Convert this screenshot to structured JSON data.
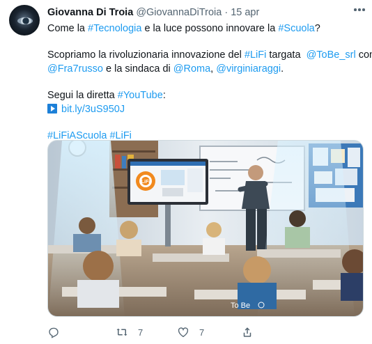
{
  "tweet": {
    "author_name": "Giovanna Di Troia",
    "author_handle": "@GiovannaDiTroia",
    "separator": "·",
    "date": "15 apr",
    "body": {
      "l1": {
        "a": "Come la ",
        "b": "#Tecnologia",
        "c": " e la luce possono innovare la ",
        "d": "#Scuola",
        "e": "?"
      },
      "l2": {
        "a": "Scopriamo la rivoluzionaria innovazione del ",
        "b": "#LiFi",
        "c": " targata  ",
        "d": "@ToBe_srl",
        "e": " con"
      },
      "l3": {
        "a": "@Fra7russo",
        "b": " e la sindaca di ",
        "c": "@Roma",
        "d": ", ",
        "e": "@virginiaraggi",
        "f": "."
      },
      "l4": {
        "a": "Segui la diretta ",
        "b": "#YouTube",
        "c": ":"
      },
      "l5": {
        "link": "bit.ly/3uS950J"
      },
      "l6": {
        "a": "#LiFiAScuola",
        "b": " ",
        "c": "#LiFi"
      }
    },
    "media": {
      "screen_title": "LiFi",
      "watermark": "To Be"
    },
    "actions": {
      "reply_count": "",
      "retweet_count": "7",
      "like_count": "7",
      "share_count": ""
    },
    "icons": {
      "more": "more-horizontal-icon",
      "play": "play-button-icon",
      "reply": "reply-icon",
      "retweet": "retweet-icon",
      "like": "heart-icon",
      "share": "share-icon"
    },
    "colors": {
      "link": "#1d9bf0",
      "text": "#0f1419",
      "secondary": "#536471"
    }
  }
}
